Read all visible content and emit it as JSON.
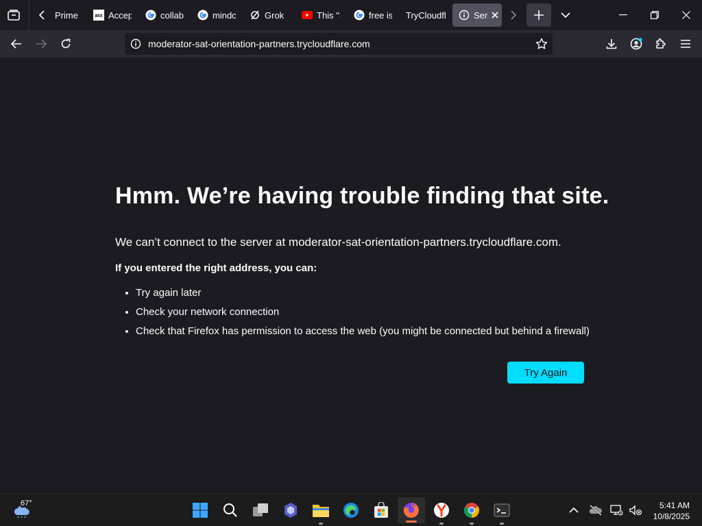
{
  "browser": {
    "tabs": [
      {
        "label": "Prime",
        "favicon": "blank"
      },
      {
        "label": "Accep",
        "favicon": "wix-icon"
      },
      {
        "label": "collab",
        "favicon": "google-icon"
      },
      {
        "label": "mindc",
        "favicon": "google-icon"
      },
      {
        "label": "Grok",
        "favicon": "grok-icon"
      },
      {
        "label": "This \"S",
        "favicon": "youtube-icon"
      },
      {
        "label": "free is",
        "favicon": "google-icon"
      },
      {
        "label": "TryCloudfl",
        "favicon": "blank"
      },
      {
        "label": "Ser",
        "favicon": "info-icon",
        "active": true
      }
    ],
    "url": "moderator-sat-orientation-partners.trycloudflare.com"
  },
  "error_page": {
    "title": "Hmm. We’re having trouble finding that site.",
    "message": "We can’t connect to the server at moderator-sat-orientation-partners.trycloudflare.com.",
    "hint_heading": "If you entered the right address, you can:",
    "tips": [
      "Try again later",
      "Check your network connection",
      "Check that Firefox has permission to access the web (you might be connected but behind a firewall)"
    ],
    "try_again_label": "Try Again"
  },
  "taskbar": {
    "weather_temp": "67°",
    "time": "5:41 AM",
    "date": "10/8/2025"
  },
  "colors": {
    "accent": "#00ddff",
    "background": "#1c1b22",
    "toolbar": "#2b2a33"
  }
}
